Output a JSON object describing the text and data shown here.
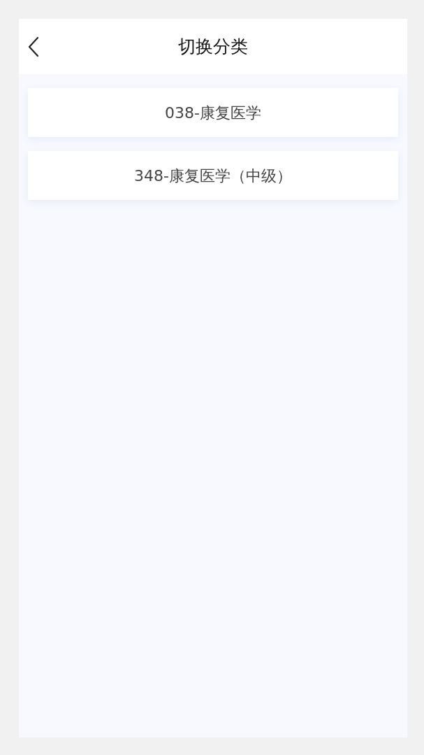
{
  "header": {
    "title": "切换分类"
  },
  "categories": [
    {
      "label": "038-康复医学"
    },
    {
      "label": "348-康复医学（中级）"
    }
  ]
}
